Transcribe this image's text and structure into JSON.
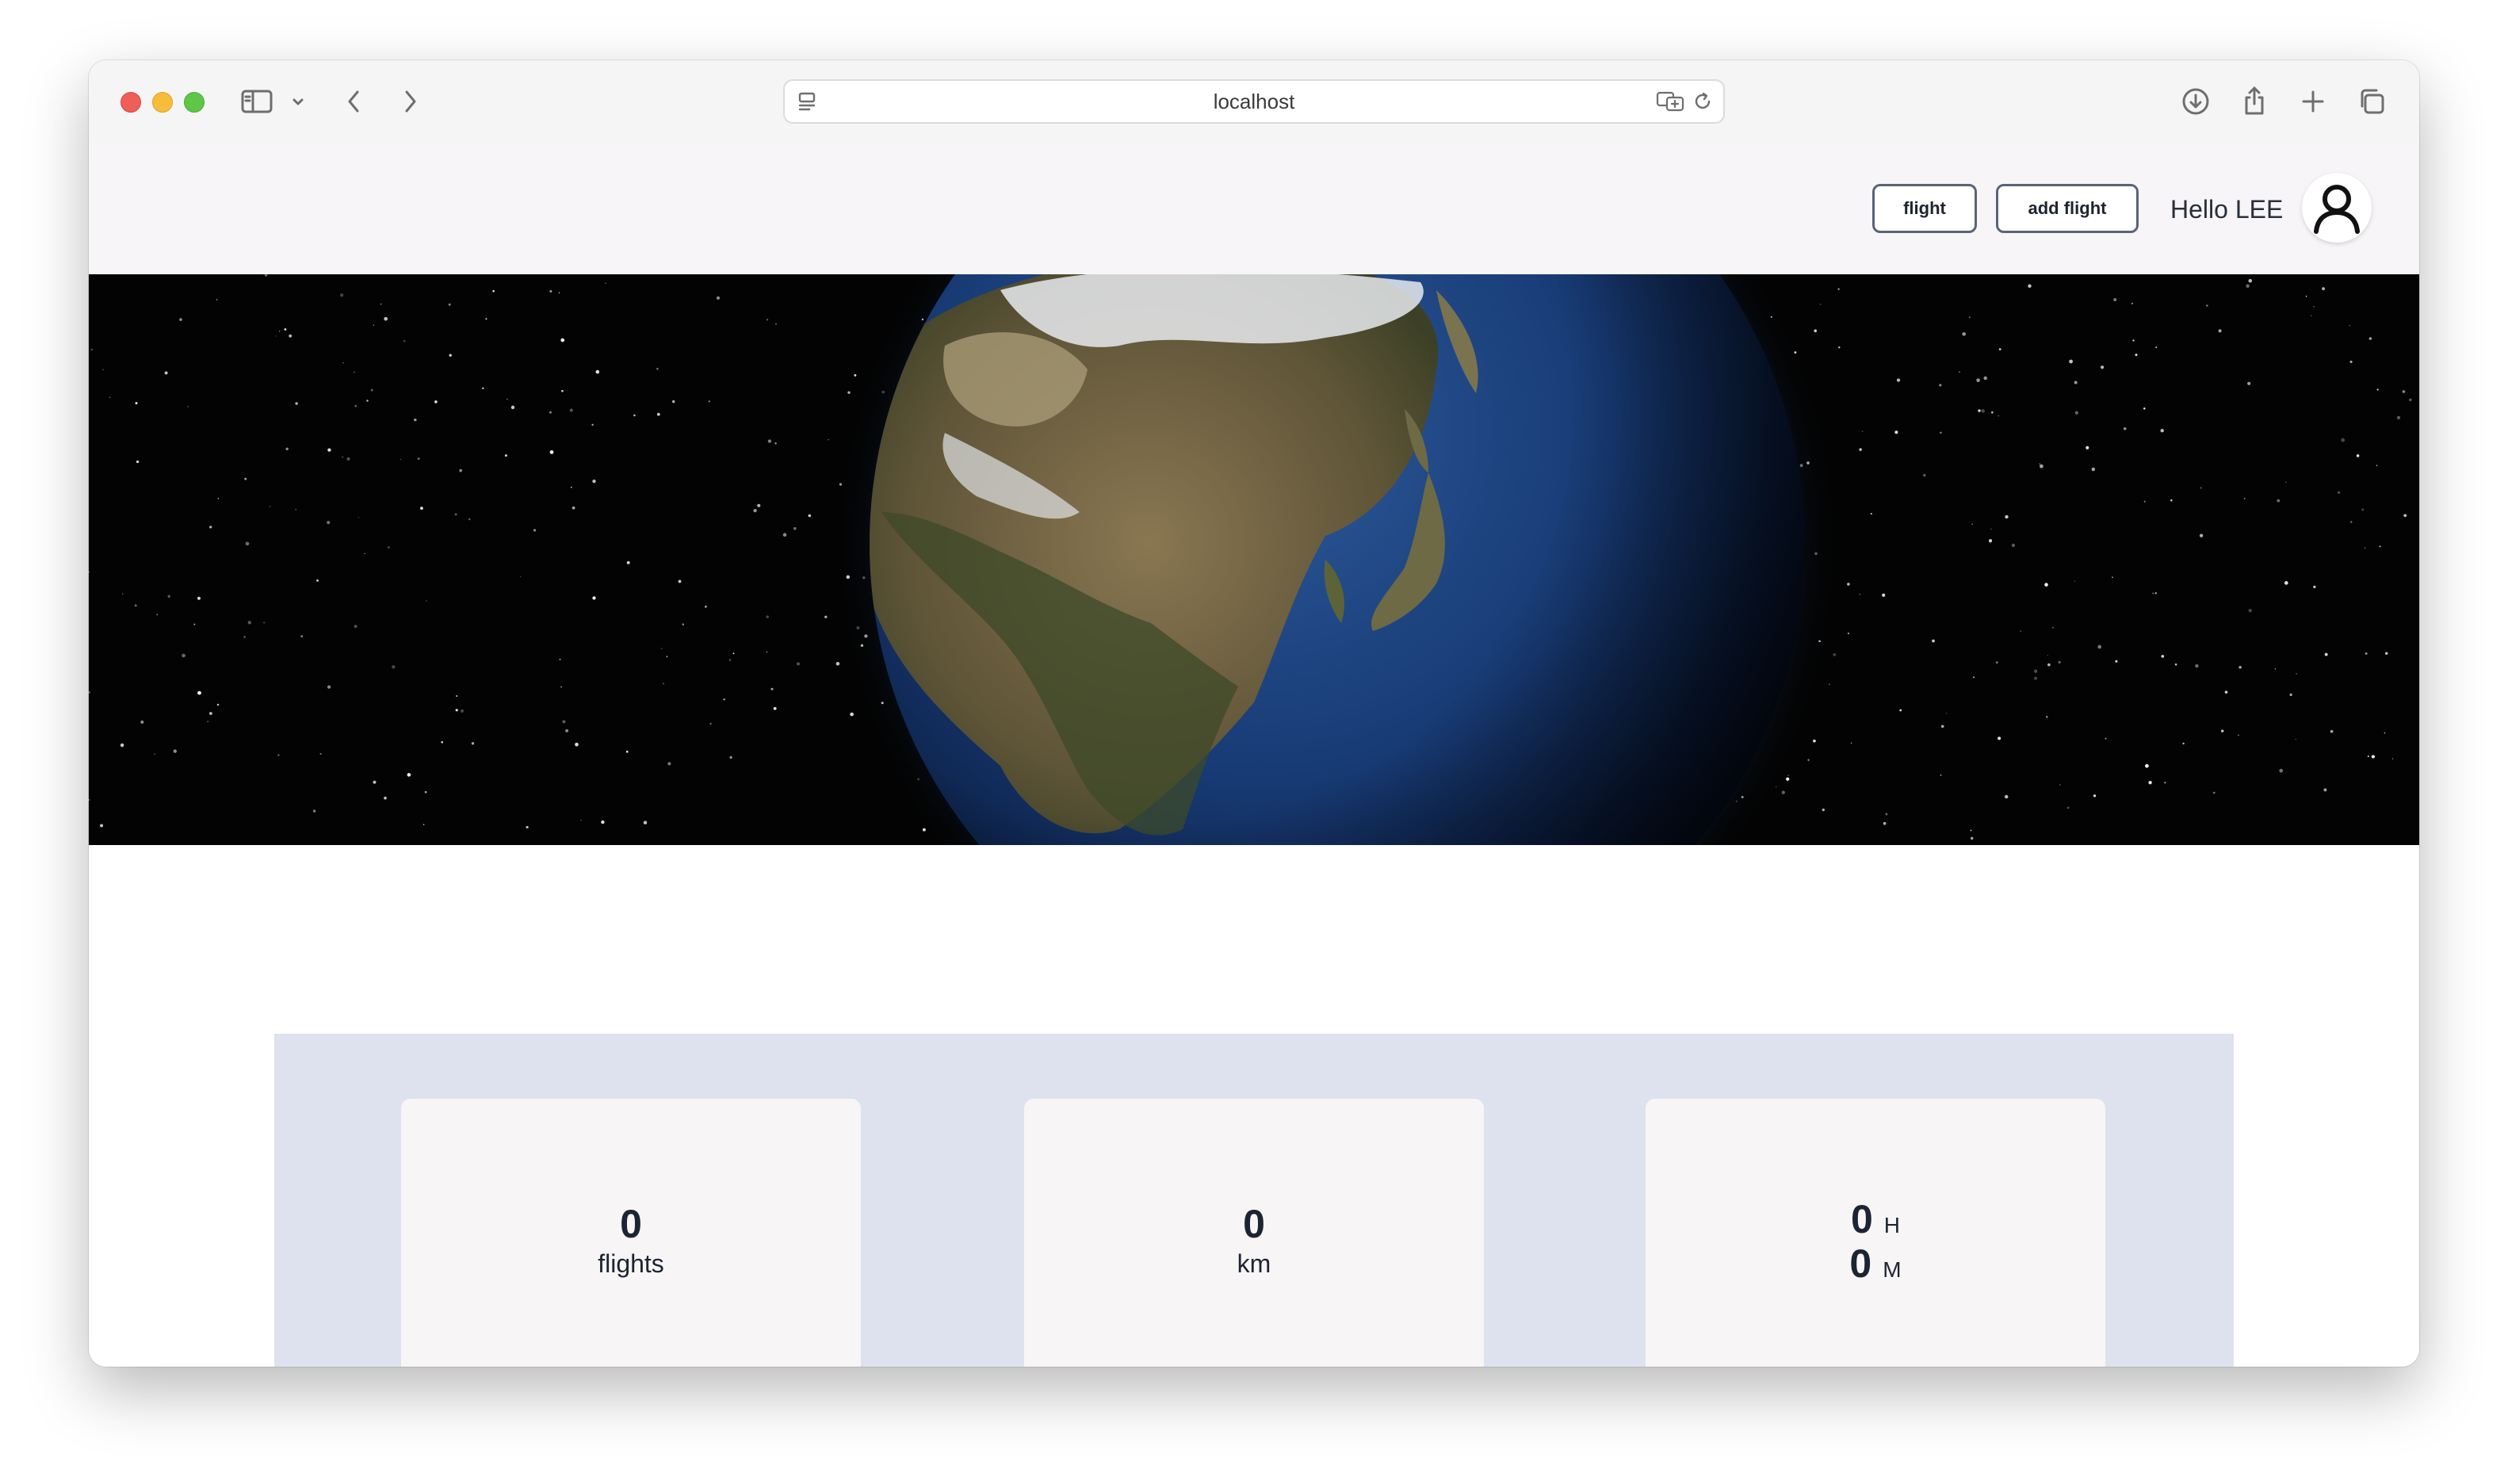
{
  "browser": {
    "url": "localhost"
  },
  "navbar": {
    "flight_button": "flight",
    "add_flight_button": "add flight",
    "greeting": "Hello LEE"
  },
  "stats": {
    "flights": {
      "value": "0",
      "label": "flights"
    },
    "distance": {
      "value": "0",
      "label": "km"
    },
    "time": {
      "hours": "0",
      "hours_unit": "H",
      "minutes": "0",
      "minutes_unit": "M"
    }
  }
}
